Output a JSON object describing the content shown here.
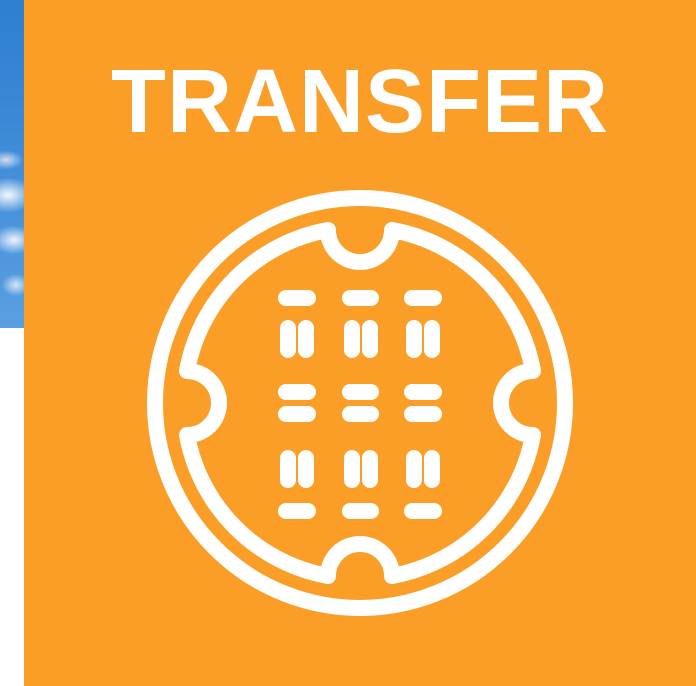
{
  "card": {
    "title": "TRANSFER",
    "icon": "manhole-cover-icon"
  },
  "colors": {
    "card_background": "#fa9e28",
    "foreground": "#ffffff",
    "sky": "#3a88d6"
  }
}
